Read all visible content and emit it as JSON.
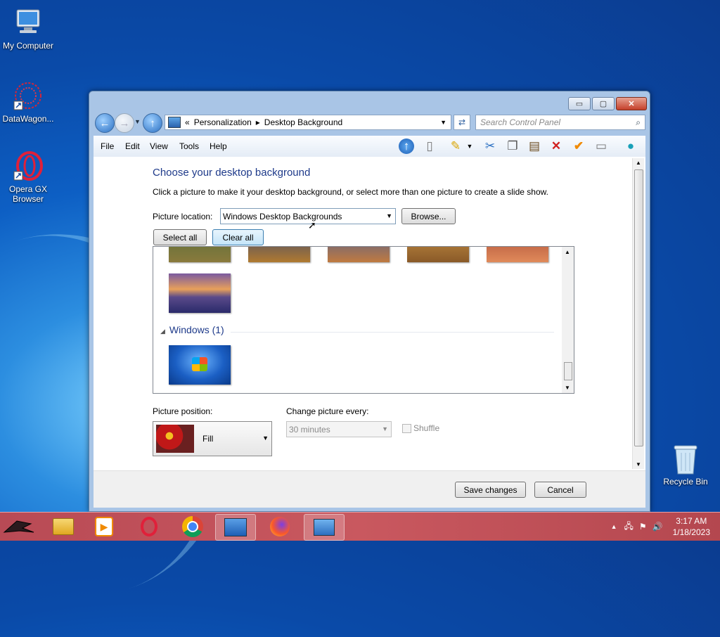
{
  "desktop": {
    "icons": [
      {
        "label": "My Computer"
      },
      {
        "label": "DataWagon..."
      },
      {
        "label": "Opera GX Browser"
      },
      {
        "label": "Recycle Bin"
      }
    ]
  },
  "window": {
    "caption_buttons": {
      "minimize": "▭",
      "maximize": "▢",
      "close": "✕"
    },
    "breadcrumb": {
      "prefix": "«",
      "items": [
        "Personalization",
        "Desktop Background"
      ]
    },
    "search": {
      "placeholder": "Search Control Panel"
    },
    "menu": [
      "File",
      "Edit",
      "View",
      "Tools",
      "Help"
    ],
    "content": {
      "heading": "Choose your desktop background",
      "subheading": "Click a picture to make it your desktop background, or select more than one picture to create a slide show.",
      "picture_location_label": "Picture location:",
      "picture_location_value": "Windows Desktop Backgrounds",
      "browse_label": "Browse...",
      "select_all_label": "Select all",
      "clear_all_label": "Clear all",
      "group_header": "Windows (1)",
      "picture_position_label": "Picture position:",
      "picture_position_value": "Fill",
      "change_every_label": "Change picture every:",
      "change_every_value": "30 minutes",
      "shuffle_label": "Shuffle"
    },
    "footer": {
      "save_label": "Save changes",
      "cancel_label": "Cancel"
    }
  },
  "taskbar": {
    "time": "3:17 AM",
    "date": "1/18/2023"
  },
  "colors": {
    "accent": "#1e3a8a",
    "taskbar": "#c9585f"
  }
}
